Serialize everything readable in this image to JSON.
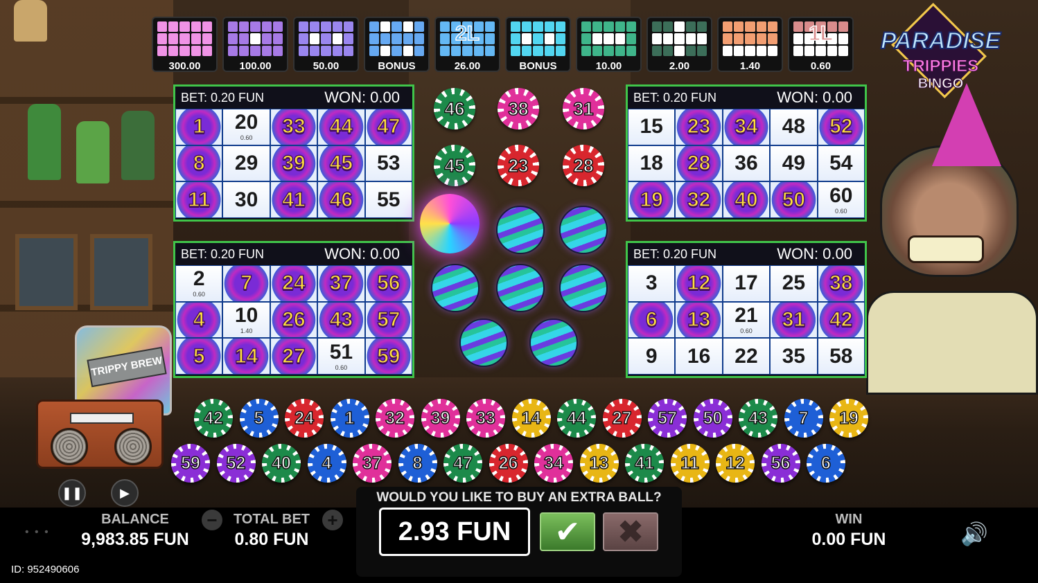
{
  "patterns": [
    {
      "value": "300.00",
      "color": "#f093e6",
      "mask": [
        1,
        1,
        1,
        1,
        1,
        1,
        1,
        1,
        1,
        1,
        1,
        1,
        1,
        1,
        1
      ],
      "overlay": ""
    },
    {
      "value": "100.00",
      "color": "#a77ae6",
      "mask": [
        1,
        1,
        1,
        1,
        1,
        1,
        1,
        0,
        1,
        1,
        1,
        1,
        1,
        1,
        1
      ],
      "overlay": ""
    },
    {
      "value": "50.00",
      "color": "#9a86ef",
      "mask": [
        1,
        1,
        1,
        1,
        1,
        1,
        0,
        1,
        0,
        1,
        1,
        1,
        1,
        1,
        1
      ],
      "overlay": ""
    },
    {
      "value": "BONUS",
      "color": "#66a9f2",
      "mask": [
        1,
        0,
        1,
        0,
        1,
        1,
        1,
        1,
        1,
        1,
        1,
        0,
        1,
        0,
        1
      ],
      "overlay": ""
    },
    {
      "value": "26.00",
      "color": "#64b8f4",
      "mask": [
        1,
        1,
        1,
        1,
        1,
        1,
        1,
        1,
        1,
        1,
        1,
        1,
        1,
        1,
        1
      ],
      "overlay": "2L"
    },
    {
      "value": "BONUS",
      "color": "#52d6f0",
      "mask": [
        1,
        1,
        1,
        1,
        1,
        1,
        0,
        1,
        0,
        1,
        1,
        1,
        1,
        1,
        1
      ],
      "overlay": ""
    },
    {
      "value": "10.00",
      "color": "#3fb58a",
      "mask": [
        1,
        1,
        1,
        1,
        1,
        1,
        0,
        0,
        0,
        1,
        1,
        1,
        1,
        1,
        1
      ],
      "overlay": ""
    },
    {
      "value": "2.00",
      "color": "#3c6e59",
      "mask": [
        1,
        1,
        0,
        1,
        1,
        0,
        0,
        0,
        0,
        0,
        1,
        1,
        0,
        1,
        1
      ],
      "overlay": ""
    },
    {
      "value": "1.40",
      "color": "#f29e72",
      "mask": [
        1,
        1,
        1,
        1,
        1,
        1,
        1,
        1,
        1,
        1,
        0,
        0,
        0,
        0,
        0
      ],
      "overlay": ""
    },
    {
      "value": "0.60",
      "color": "#d98c8c",
      "mask": [
        1,
        1,
        1,
        1,
        1,
        0,
        0,
        0,
        0,
        0,
        0,
        0,
        0,
        0,
        0
      ],
      "overlay": "1L"
    }
  ],
  "logo": {
    "line1": "PARADISE",
    "line2": "TRIPPIES",
    "line3": "BINGO"
  },
  "cards": [
    {
      "bet": "BET: 0.20 FUN",
      "won": "WON: 0.00",
      "cells": [
        {
          "n": "1",
          "m": true,
          "p": ""
        },
        {
          "n": "20",
          "m": false,
          "p": "0.60"
        },
        {
          "n": "33",
          "m": true,
          "p": ""
        },
        {
          "n": "44",
          "m": true,
          "p": ""
        },
        {
          "n": "47",
          "m": true,
          "p": ""
        },
        {
          "n": "8",
          "m": true,
          "p": ""
        },
        {
          "n": "29",
          "m": false,
          "p": ""
        },
        {
          "n": "39",
          "m": true,
          "p": ""
        },
        {
          "n": "45",
          "m": true,
          "p": ""
        },
        {
          "n": "53",
          "m": false,
          "p": ""
        },
        {
          "n": "11",
          "m": true,
          "p": ""
        },
        {
          "n": "30",
          "m": false,
          "p": ""
        },
        {
          "n": "41",
          "m": true,
          "p": ""
        },
        {
          "n": "46",
          "m": true,
          "p": ""
        },
        {
          "n": "55",
          "m": false,
          "p": ""
        }
      ]
    },
    {
      "bet": "BET: 0.20 FUN",
      "won": "WON: 0.00",
      "cells": [
        {
          "n": "15",
          "m": false,
          "p": ""
        },
        {
          "n": "23",
          "m": true,
          "p": ""
        },
        {
          "n": "34",
          "m": true,
          "p": ""
        },
        {
          "n": "48",
          "m": false,
          "p": ""
        },
        {
          "n": "52",
          "m": true,
          "p": ""
        },
        {
          "n": "18",
          "m": false,
          "p": ""
        },
        {
          "n": "28",
          "m": true,
          "p": ""
        },
        {
          "n": "36",
          "m": false,
          "p": ""
        },
        {
          "n": "49",
          "m": false,
          "p": ""
        },
        {
          "n": "54",
          "m": false,
          "p": ""
        },
        {
          "n": "19",
          "m": true,
          "p": ""
        },
        {
          "n": "32",
          "m": true,
          "p": ""
        },
        {
          "n": "40",
          "m": true,
          "p": ""
        },
        {
          "n": "50",
          "m": true,
          "p": ""
        },
        {
          "n": "60",
          "m": false,
          "p": "0.60"
        }
      ]
    },
    {
      "bet": "BET: 0.20 FUN",
      "won": "WON: 0.00",
      "cells": [
        {
          "n": "2",
          "m": false,
          "p": "0.60"
        },
        {
          "n": "7",
          "m": true,
          "p": ""
        },
        {
          "n": "24",
          "m": true,
          "p": ""
        },
        {
          "n": "37",
          "m": true,
          "p": ""
        },
        {
          "n": "56",
          "m": true,
          "p": ""
        },
        {
          "n": "4",
          "m": true,
          "p": ""
        },
        {
          "n": "10",
          "m": false,
          "p": "1.40"
        },
        {
          "n": "26",
          "m": true,
          "p": ""
        },
        {
          "n": "43",
          "m": true,
          "p": ""
        },
        {
          "n": "57",
          "m": true,
          "p": ""
        },
        {
          "n": "5",
          "m": true,
          "p": ""
        },
        {
          "n": "14",
          "m": true,
          "p": ""
        },
        {
          "n": "27",
          "m": true,
          "p": ""
        },
        {
          "n": "51",
          "m": false,
          "p": "0.60"
        },
        {
          "n": "59",
          "m": true,
          "p": ""
        }
      ]
    },
    {
      "bet": "BET: 0.20 FUN",
      "won": "WON: 0.00",
      "cells": [
        {
          "n": "3",
          "m": false,
          "p": ""
        },
        {
          "n": "12",
          "m": true,
          "p": ""
        },
        {
          "n": "17",
          "m": false,
          "p": ""
        },
        {
          "n": "25",
          "m": false,
          "p": ""
        },
        {
          "n": "38",
          "m": true,
          "p": ""
        },
        {
          "n": "6",
          "m": true,
          "p": ""
        },
        {
          "n": "13",
          "m": true,
          "p": ""
        },
        {
          "n": "21",
          "m": false,
          "p": "0.60"
        },
        {
          "n": "31",
          "m": true,
          "p": ""
        },
        {
          "n": "42",
          "m": true,
          "p": ""
        },
        {
          "n": "9",
          "m": false,
          "p": ""
        },
        {
          "n": "16",
          "m": false,
          "p": ""
        },
        {
          "n": "22",
          "m": false,
          "p": ""
        },
        {
          "n": "35",
          "m": false,
          "p": ""
        },
        {
          "n": "58",
          "m": false,
          "p": ""
        }
      ]
    }
  ],
  "center_balls": [
    {
      "n": "46",
      "color": "#1c8a4a"
    },
    {
      "n": "38",
      "color": "#e0309a"
    },
    {
      "n": "31",
      "color": "#e0309a"
    },
    {
      "n": "45",
      "color": "#1c8a4a"
    },
    {
      "n": "23",
      "color": "#d8262e"
    },
    {
      "n": "28",
      "color": "#d8262e"
    }
  ],
  "drawn_row1": [
    {
      "n": "42",
      "color": "#1c8a4a"
    },
    {
      "n": "5",
      "color": "#1e5fd6"
    },
    {
      "n": "24",
      "color": "#d8262e"
    },
    {
      "n": "1",
      "color": "#1e5fd6"
    },
    {
      "n": "32",
      "color": "#e0309a"
    },
    {
      "n": "39",
      "color": "#e0309a"
    },
    {
      "n": "33",
      "color": "#e0309a"
    },
    {
      "n": "14",
      "color": "#e8b615"
    },
    {
      "n": "44",
      "color": "#1c8a4a"
    },
    {
      "n": "27",
      "color": "#d8262e"
    },
    {
      "n": "57",
      "color": "#8a2ed6"
    },
    {
      "n": "50",
      "color": "#8a2ed6"
    },
    {
      "n": "43",
      "color": "#1c8a4a"
    },
    {
      "n": "7",
      "color": "#1e5fd6"
    },
    {
      "n": "19",
      "color": "#e8b615"
    }
  ],
  "drawn_row2": [
    {
      "n": "59",
      "color": "#8a2ed6"
    },
    {
      "n": "52",
      "color": "#8a2ed6"
    },
    {
      "n": "40",
      "color": "#1c8a4a"
    },
    {
      "n": "4",
      "color": "#1e5fd6"
    },
    {
      "n": "37",
      "color": "#e0309a"
    },
    {
      "n": "8",
      "color": "#1e5fd6"
    },
    {
      "n": "47",
      "color": "#1c8a4a"
    },
    {
      "n": "26",
      "color": "#d8262e"
    },
    {
      "n": "34",
      "color": "#e0309a"
    },
    {
      "n": "13",
      "color": "#e8b615"
    },
    {
      "n": "41",
      "color": "#1c8a4a"
    },
    {
      "n": "11",
      "color": "#e8b615"
    },
    {
      "n": "12",
      "color": "#e8b615"
    },
    {
      "n": "56",
      "color": "#8a2ed6"
    },
    {
      "n": "6",
      "color": "#1e5fd6"
    }
  ],
  "jar_label": "TRIPPY BREW",
  "controls": {
    "pause_icon": "pause-icon",
    "play_icon": "play-icon"
  },
  "balance": {
    "label": "BALANCE",
    "value": "9,983.85 FUN"
  },
  "total_bet": {
    "label": "TOTAL BET",
    "value": "0.80 FUN",
    "minus": "−",
    "plus": "+"
  },
  "extra_ball": {
    "question": "WOULD YOU LIKE TO BUY AN EXTRA BALL?",
    "price": "2.93 FUN",
    "yes": "✔",
    "no": "✖"
  },
  "win": {
    "label": "WIN",
    "value": "0.00 FUN"
  },
  "sound_icon": "🔊",
  "id_text": "ID: 952490606",
  "menu_dots": "• • •"
}
